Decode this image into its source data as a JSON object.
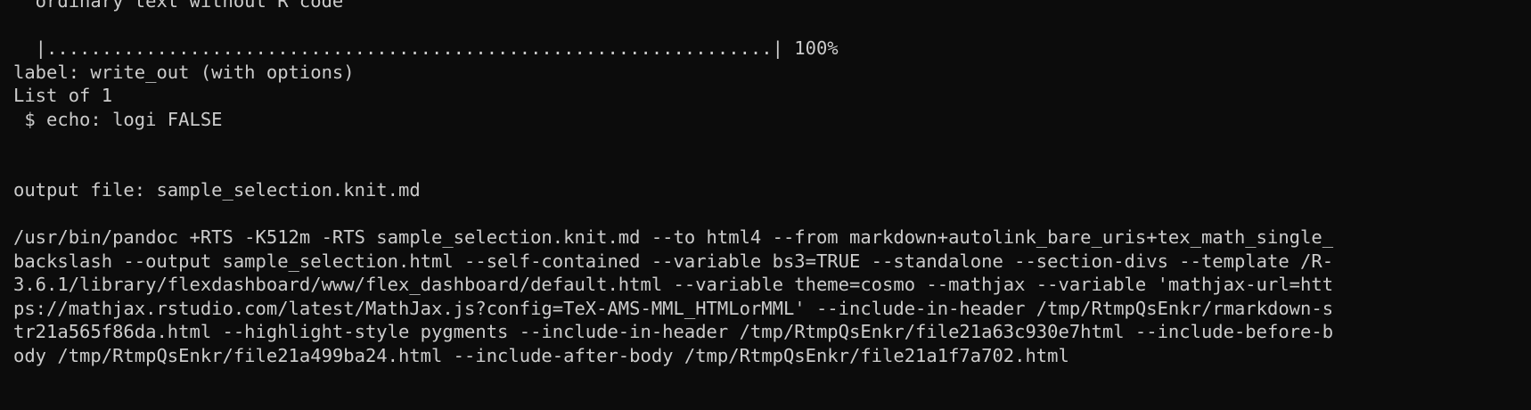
{
  "terminal": {
    "lines": [
      "  ordinary text without R code",
      "",
      "  |..................................................................| 100%",
      "label: write_out (with options)",
      "List of 1",
      " $ echo: logi FALSE",
      "",
      "",
      "output file: sample_selection.knit.md",
      "",
      "/usr/bin/pandoc +RTS -K512m -RTS sample_selection.knit.md --to html4 --from markdown+autolink_bare_uris+tex_math_single_",
      "backslash --output sample_selection.html --self-contained --variable bs3=TRUE --standalone --section-divs --template /R-",
      "3.6.1/library/flexdashboard/www/flex_dashboard/default.html --variable theme=cosmo --mathjax --variable 'mathjax-url=htt",
      "ps://mathjax.rstudio.com/latest/MathJax.js?config=TeX-AMS-MML_HTMLorMML' --include-in-header /tmp/RtmpQsEnkr/rmarkdown-s",
      "tr21a565f86da.html --highlight-style pygments --include-in-header /tmp/RtmpQsEnkr/file21a63c930e7html --include-before-b",
      "ody /tmp/RtmpQsEnkr/file21a499ba24.html --include-after-body /tmp/RtmpQsEnkr/file21a1f7a702.html"
    ]
  }
}
